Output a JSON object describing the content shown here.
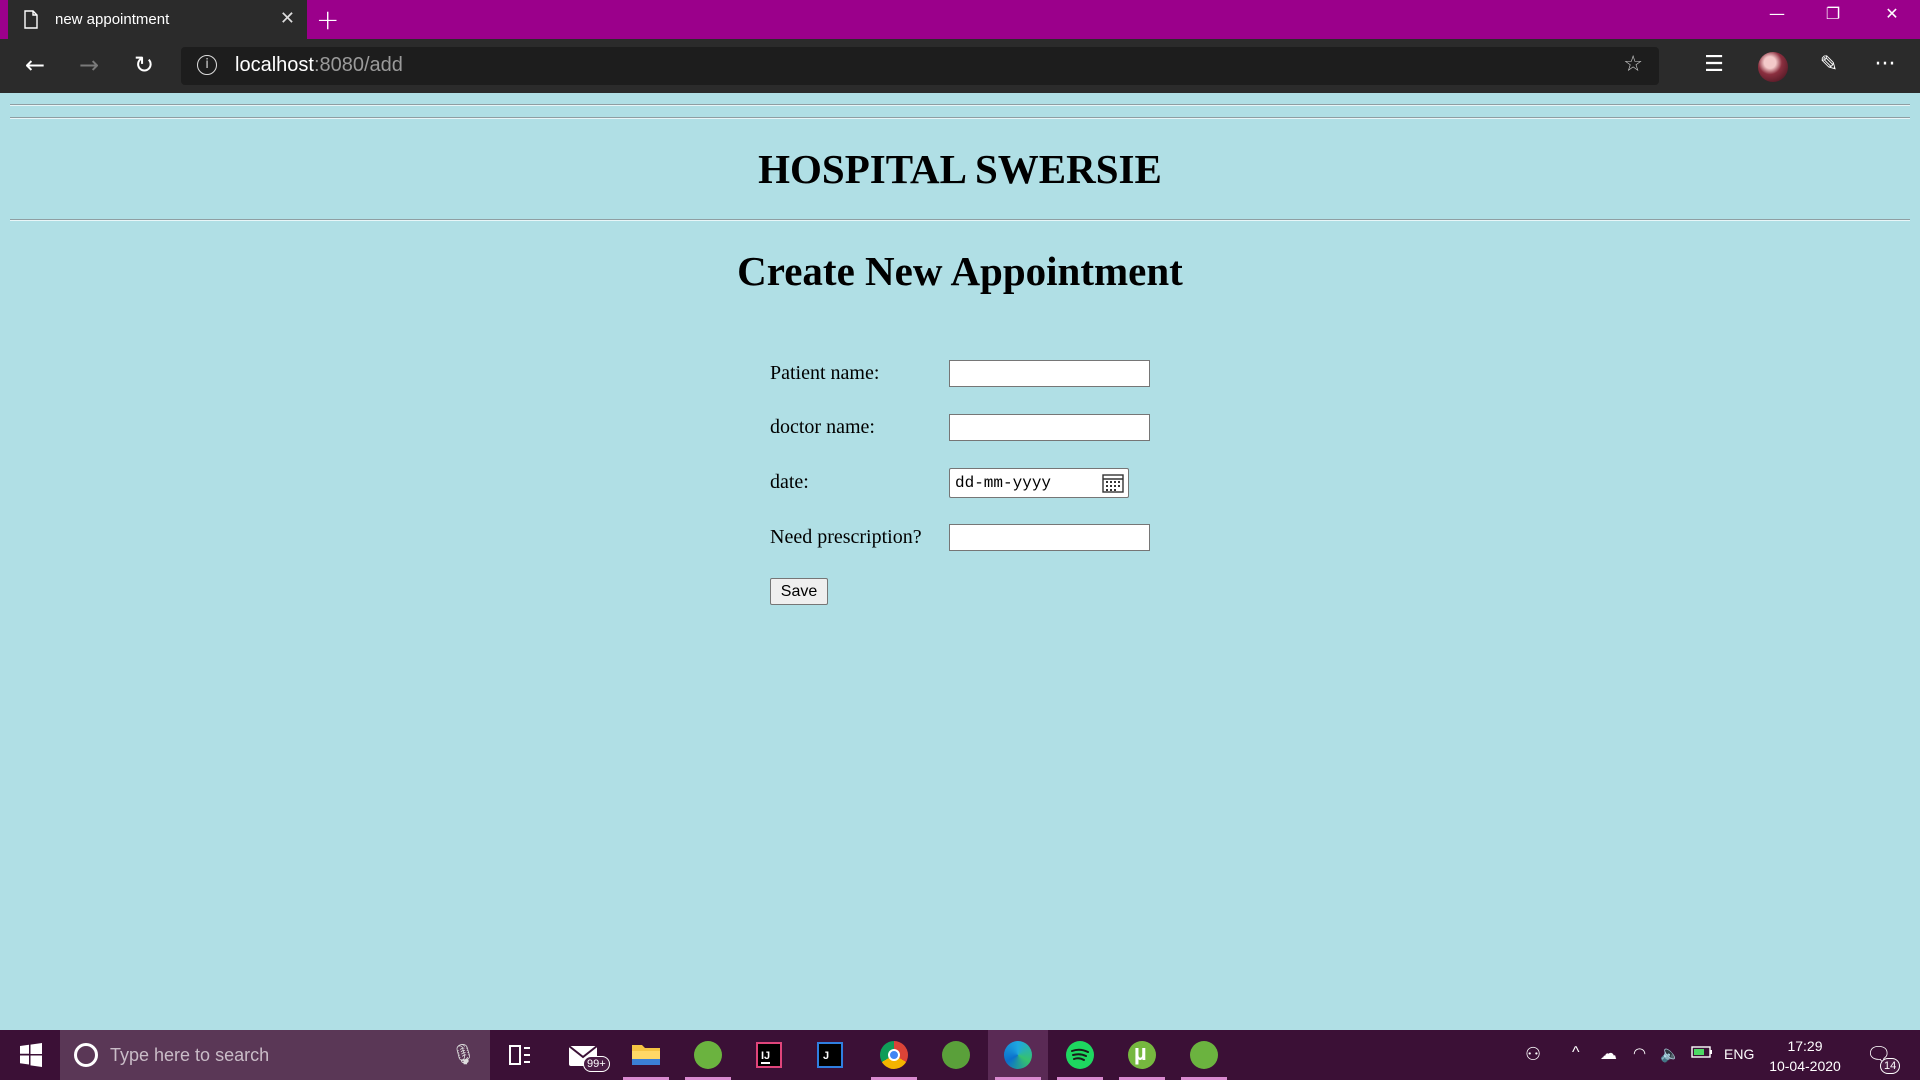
{
  "browser": {
    "tab_title": "new appointment",
    "tab_close_icon": "close-icon",
    "new_tab_icon": "plus-icon",
    "url_host": "localhost",
    "url_rest": ":8080/add",
    "controls": {
      "minimize": "minimize-icon",
      "restore": "restore-icon",
      "close": "close-icon"
    },
    "toolbar_icons": [
      "back-arrow-icon",
      "forward-arrow-icon",
      "refresh-icon",
      "info-icon",
      "star-icon",
      "favorites-icon",
      "profile-avatar",
      "share-icon",
      "more-icon"
    ]
  },
  "page": {
    "site_title": "HOSPITAL SWERSIE",
    "heading": "Create New Appointment",
    "form": {
      "patient_label": "Patient name:",
      "patient_value": "",
      "doctor_label": "doctor name:",
      "doctor_value": "",
      "date_label": "date:",
      "date_placeholder": "dd-mm-yyyy",
      "prescription_label": "Need prescription?",
      "prescription_value": "",
      "save_label": "Save"
    }
  },
  "taskbar": {
    "search_placeholder": "Type here to search",
    "mail_badge": "99+",
    "language": "ENG",
    "time": "17:29",
    "date": "10-04-2020",
    "notification_count": "14",
    "apps": [
      "mail-icon",
      "file-explorer-icon",
      "spring-tool-icon",
      "intellij-icon",
      "visual-studio-icon",
      "chrome-icon",
      "spring-icon",
      "edge-icon",
      "spotify-icon",
      "utorrent-icon",
      "spring-boot-icon"
    ],
    "colors": {
      "bar": "#3b1036",
      "accent": "#9b008b",
      "page_bg": "#b0dfe5"
    }
  }
}
